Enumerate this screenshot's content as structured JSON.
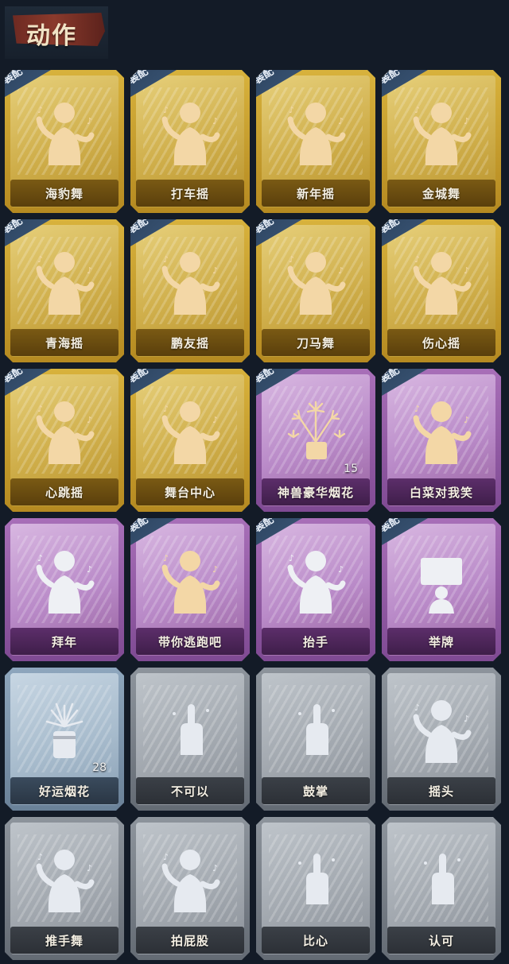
{
  "header": {
    "title": "动作"
  },
  "equipped_tag": "装配",
  "colors": {
    "gold": "#c9a232",
    "purple": "#9b63ae",
    "blue": "#8aa0b5",
    "gray": "#8a9098",
    "background": "#131b27"
  },
  "actions": [
    {
      "label": "海豹舞",
      "rarity": "gold",
      "equipped": true,
      "icon": "dance-figure-icon"
    },
    {
      "label": "打车摇",
      "rarity": "gold",
      "equipped": true,
      "icon": "dance-figure-icon"
    },
    {
      "label": "新年摇",
      "rarity": "gold",
      "equipped": true,
      "icon": "dance-figure-icon"
    },
    {
      "label": "金城舞",
      "rarity": "gold",
      "equipped": true,
      "icon": "dance-figure-icon"
    },
    {
      "label": "青海摇",
      "rarity": "gold",
      "equipped": true,
      "icon": "dance-figure-icon"
    },
    {
      "label": "鹏友摇",
      "rarity": "gold",
      "equipped": true,
      "icon": "dance-figure-icon"
    },
    {
      "label": "刀马舞",
      "rarity": "gold",
      "equipped": true,
      "icon": "dance-figure-icon"
    },
    {
      "label": "伤心摇",
      "rarity": "gold",
      "equipped": true,
      "icon": "heart-hands-figure-icon"
    },
    {
      "label": "心跳摇",
      "rarity": "gold",
      "equipped": true,
      "icon": "dance-figure-icon"
    },
    {
      "label": "舞台中心",
      "rarity": "gold",
      "equipped": true,
      "icon": "dance-figure-icon"
    },
    {
      "label": "神兽豪华烟花",
      "rarity": "purple",
      "equipped": true,
      "icon": "fireworks-icon",
      "count": "15"
    },
    {
      "label": "白菜对我笑",
      "rarity": "purple",
      "equipped": true,
      "icon": "dance-figure-icon"
    },
    {
      "label": "拜年",
      "rarity": "purple",
      "equipped": false,
      "icon": "greeting-figure-icon"
    },
    {
      "label": "带你逃跑吧",
      "rarity": "purple",
      "equipped": true,
      "icon": "dance-figure-icon"
    },
    {
      "label": "抬手",
      "rarity": "purple",
      "equipped": true,
      "icon": "raise-hand-figure-icon"
    },
    {
      "label": "举牌",
      "rarity": "purple",
      "equipped": true,
      "icon": "sign-figure-icon"
    },
    {
      "label": "好运烟花",
      "rarity": "blue",
      "equipped": false,
      "icon": "firework-can-icon",
      "count": "28"
    },
    {
      "label": "不可以",
      "rarity": "gray",
      "equipped": false,
      "icon": "finger-wag-icon"
    },
    {
      "label": "鼓掌",
      "rarity": "gray",
      "equipped": false,
      "icon": "clap-hands-icon"
    },
    {
      "label": "摇头",
      "rarity": "gray",
      "equipped": false,
      "icon": "shake-head-figure-icon"
    },
    {
      "label": "推手舞",
      "rarity": "gray",
      "equipped": false,
      "icon": "push-dance-figure-icon"
    },
    {
      "label": "拍屁股",
      "rarity": "gray",
      "equipped": false,
      "icon": "pat-figure-icon"
    },
    {
      "label": "比心",
      "rarity": "gray",
      "equipped": false,
      "icon": "finger-heart-icon"
    },
    {
      "label": "认可",
      "rarity": "gray",
      "equipped": false,
      "icon": "thumbs-up-icon"
    }
  ]
}
